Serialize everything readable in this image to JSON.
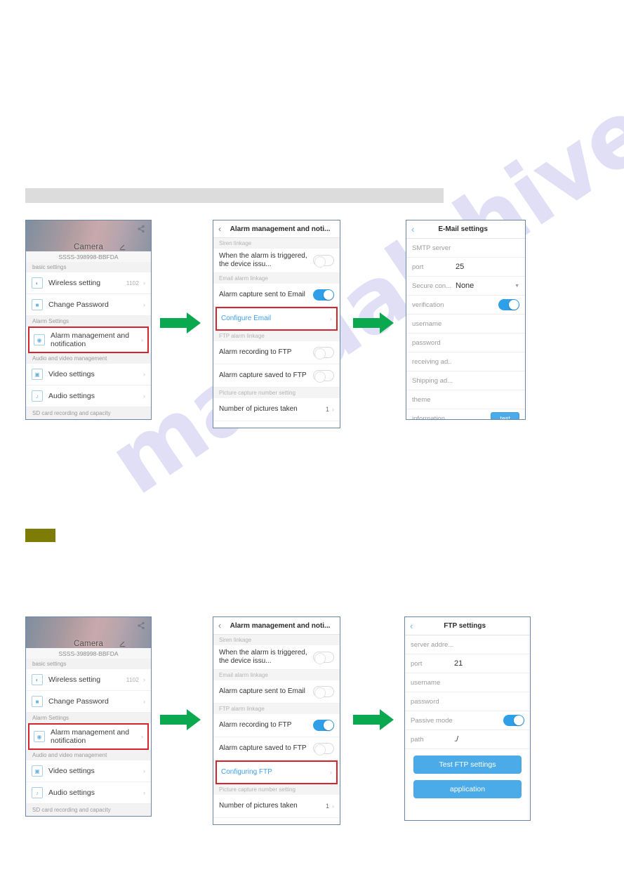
{
  "page": {
    "watermark_text": "manualshive.com"
  },
  "flow_email": {
    "camera_screen": {
      "title": "Camera",
      "uid": "SSSS-398998-BBFDA",
      "share_icon": "share-icon",
      "edit_icon": "edit-icon",
      "groups": [
        {
          "label": "basic settings",
          "items": [
            {
              "icon": "wifi-icon",
              "label": "Wireless setting",
              "value": "1102",
              "chevron": "›",
              "highlight": false
            },
            {
              "icon": "lock-icon",
              "label": "Change Password",
              "value": "",
              "chevron": "›",
              "highlight": false
            }
          ]
        },
        {
          "label": "Alarm Settings",
          "items": [
            {
              "icon": "alarm-icon",
              "label": "Alarm management and notification",
              "value": "",
              "chevron": "›",
              "highlight": true
            }
          ]
        },
        {
          "label": "Audio and video management",
          "items": [
            {
              "icon": "video-icon",
              "label": "Video settings",
              "value": "",
              "chevron": "›",
              "highlight": false
            },
            {
              "icon": "audio-icon",
              "label": "Audio settings",
              "value": "",
              "chevron": "›",
              "highlight": false
            }
          ]
        }
      ],
      "footer_label": "SD card recording and capacity"
    },
    "alarm_screen": {
      "back_icon": "chevron-left-icon",
      "title": "Alarm management and noti...",
      "sections": [
        {
          "label": "Siren linkage",
          "rows": [
            {
              "label": "When the alarm is triggered, the device issu...",
              "control": "toggle",
              "toggle_on": false
            }
          ]
        },
        {
          "label": "Email alarm linkage",
          "rows": [
            {
              "label": "Alarm capture sent to Email",
              "control": "toggle",
              "toggle_on": true
            },
            {
              "label": "Configure Email",
              "control": "chevron",
              "link": true,
              "highlight": true,
              "chevron": "›"
            }
          ]
        },
        {
          "label": "FTP alarm linkage",
          "rows": [
            {
              "label": "Alarm recording to FTP",
              "control": "toggle",
              "toggle_on": false
            },
            {
              "label": "Alarm capture saved to FTP",
              "control": "toggle",
              "toggle_on": false
            }
          ]
        },
        {
          "label": "Picture capture number setting",
          "rows": [
            {
              "label": "Number of pictures taken",
              "control": "value",
              "value": "1",
              "chevron": "›"
            }
          ]
        }
      ]
    },
    "detail_screen": {
      "back_icon": "chevron-left-icon",
      "title": "E-Mail settings",
      "fields": [
        {
          "key": "SMTP server",
          "value": ""
        },
        {
          "key": "port",
          "value": "25"
        },
        {
          "key": "Secure con...",
          "value": "None",
          "caret": true
        },
        {
          "key": "verification",
          "value": "",
          "control": "toggle",
          "toggle_on": true
        },
        {
          "key": "username",
          "value": ""
        },
        {
          "key": "password",
          "value": ""
        },
        {
          "key": "receiving ad..",
          "value": ""
        },
        {
          "key": "Shipping ad...",
          "value": ""
        },
        {
          "key": "theme",
          "value": ""
        },
        {
          "key": "information",
          "value": "",
          "control": "button",
          "button_label": "test"
        }
      ]
    }
  },
  "flow_ftp": {
    "camera_screen": {
      "title": "Camera",
      "uid": "SSSS-398998-BBFDA",
      "share_icon": "share-icon",
      "edit_icon": "edit-icon",
      "groups": [
        {
          "label": "basic settings",
          "items": [
            {
              "icon": "wifi-icon",
              "label": "Wireless setting",
              "value": "1102",
              "chevron": "›",
              "highlight": false
            },
            {
              "icon": "lock-icon",
              "label": "Change Password",
              "value": "",
              "chevron": "›",
              "highlight": false
            }
          ]
        },
        {
          "label": "Alarm Settings",
          "items": [
            {
              "icon": "alarm-icon",
              "label": "Alarm management and notification",
              "value": "",
              "chevron": "›",
              "highlight": true
            }
          ]
        },
        {
          "label": "Audio and video management",
          "items": [
            {
              "icon": "video-icon",
              "label": "Video settings",
              "value": "",
              "chevron": "›",
              "highlight": false
            },
            {
              "icon": "audio-icon",
              "label": "Audio settings",
              "value": "",
              "chevron": "›",
              "highlight": false
            }
          ]
        }
      ],
      "footer_label": "SD card recording and capacity"
    },
    "alarm_screen": {
      "back_icon": "chevron-left-icon",
      "title": "Alarm management and noti...",
      "sections": [
        {
          "label": "Siren linkage",
          "rows": [
            {
              "label": "When the alarm is triggered, the device issu...",
              "control": "toggle",
              "toggle_on": false
            }
          ]
        },
        {
          "label": "Email alarm linkage",
          "rows": [
            {
              "label": "Alarm capture sent to Email",
              "control": "toggle",
              "toggle_on": false
            }
          ]
        },
        {
          "label": "FTP alarm linkage",
          "rows": [
            {
              "label": "Alarm recording to FTP",
              "control": "toggle",
              "toggle_on": true
            },
            {
              "label": "Alarm capture saved to FTP",
              "control": "toggle",
              "toggle_on": false
            },
            {
              "label": "Configuring FTP",
              "control": "chevron",
              "link": true,
              "highlight": true,
              "chevron": "›"
            }
          ]
        },
        {
          "label": "Picture capture number setting",
          "rows": [
            {
              "label": "Number of pictures taken",
              "control": "value",
              "value": "1",
              "chevron": "›"
            }
          ]
        }
      ]
    },
    "detail_screen": {
      "back_icon": "chevron-left-icon",
      "title": "FTP settings",
      "fields": [
        {
          "key": "server addre...",
          "value": ""
        },
        {
          "key": "port",
          "value": "21"
        },
        {
          "key": "username",
          "value": ""
        },
        {
          "key": "password",
          "value": ""
        },
        {
          "key": "Passive mode",
          "value": "",
          "control": "toggle",
          "toggle_on": true
        },
        {
          "key": "path",
          "value": "./"
        }
      ],
      "buttons": [
        {
          "label": "Test FTP settings"
        },
        {
          "label": "application"
        }
      ]
    }
  },
  "colors": {
    "accent_blue": "#4aabe8",
    "toggle_on": "#2f9fe8",
    "highlight_red": "#d6242c",
    "arrow_green": "#0aa84f",
    "grey_bar": "#dcdcdc",
    "olive_block": "#7c7c06",
    "watermark": "#c9c6ef"
  }
}
